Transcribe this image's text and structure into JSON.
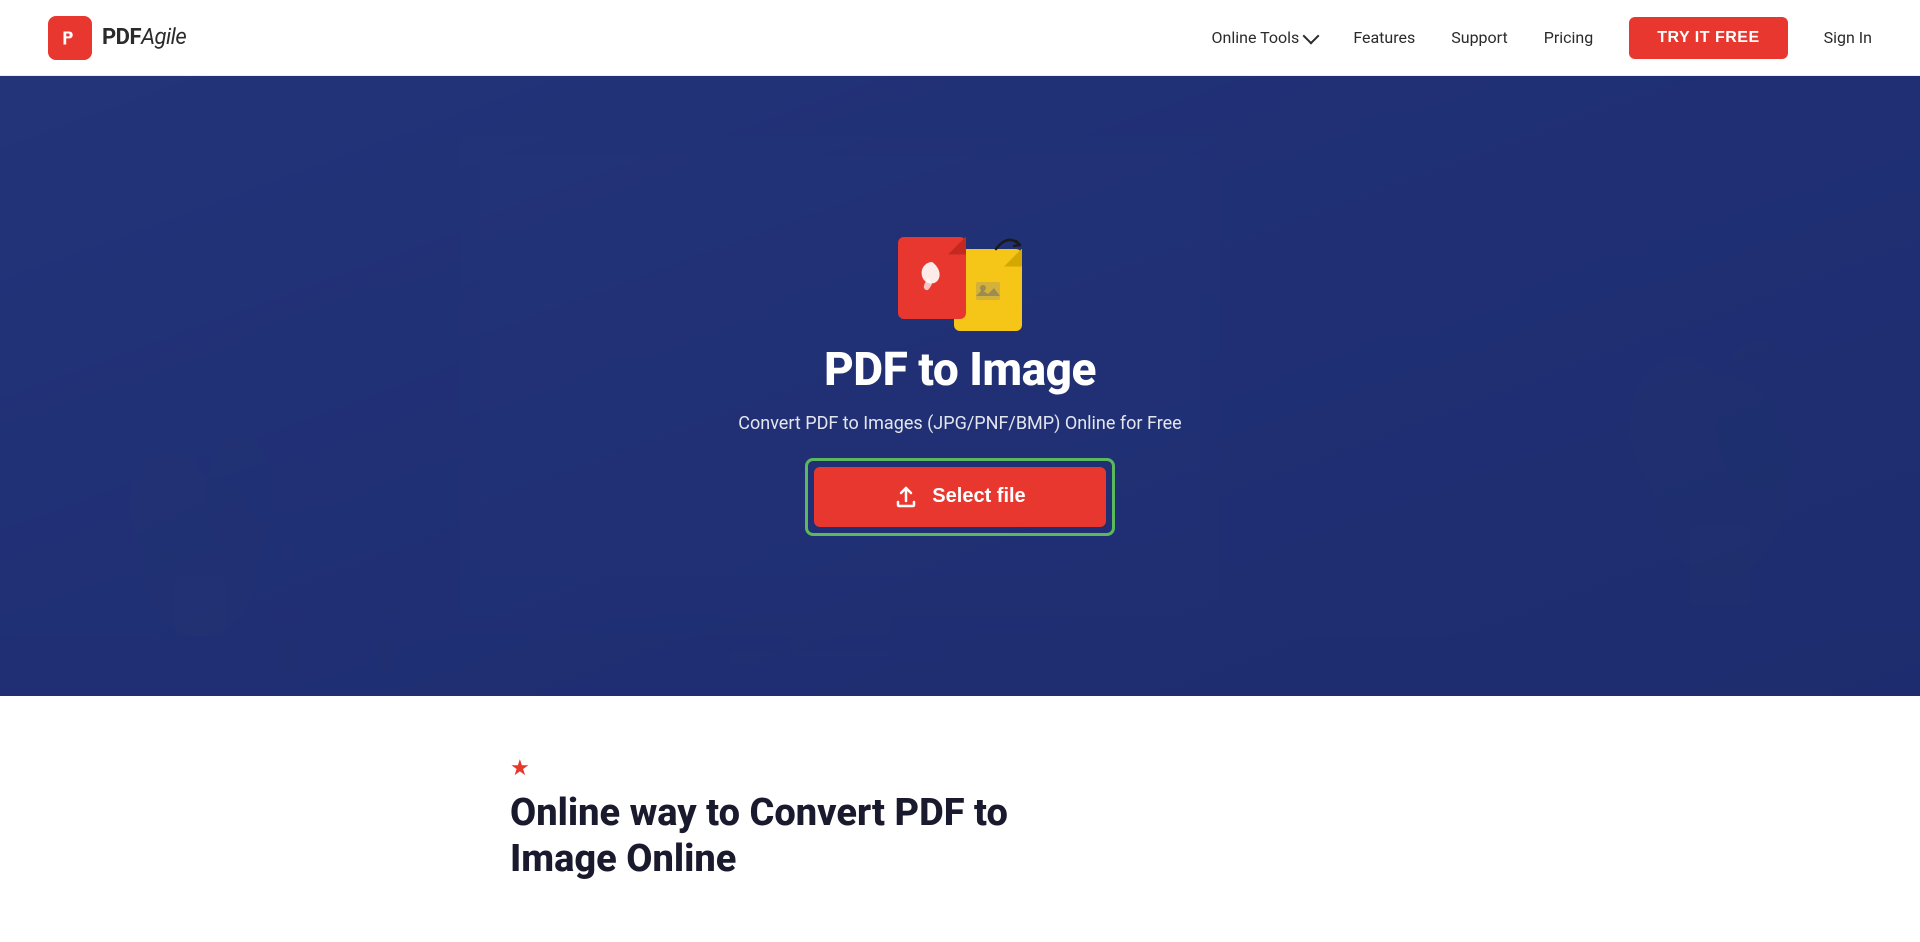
{
  "navbar": {
    "logo_pdf": "PDF",
    "logo_agile": "Agile",
    "nav_online_tools": "Online Tools",
    "nav_features": "Features",
    "nav_support": "Support",
    "nav_pricing": "Pricing",
    "btn_try_free": "TRY IT FREE",
    "btn_sign_in": "Sign In"
  },
  "hero": {
    "title": "PDF to Image",
    "subtitle": "Convert PDF to Images (JPG/PNF/BMP) Online for Free",
    "select_file_label": "Select file"
  },
  "bottom": {
    "heading_line1": "Online way to Convert PDF to",
    "heading_line2": "Image Online"
  }
}
